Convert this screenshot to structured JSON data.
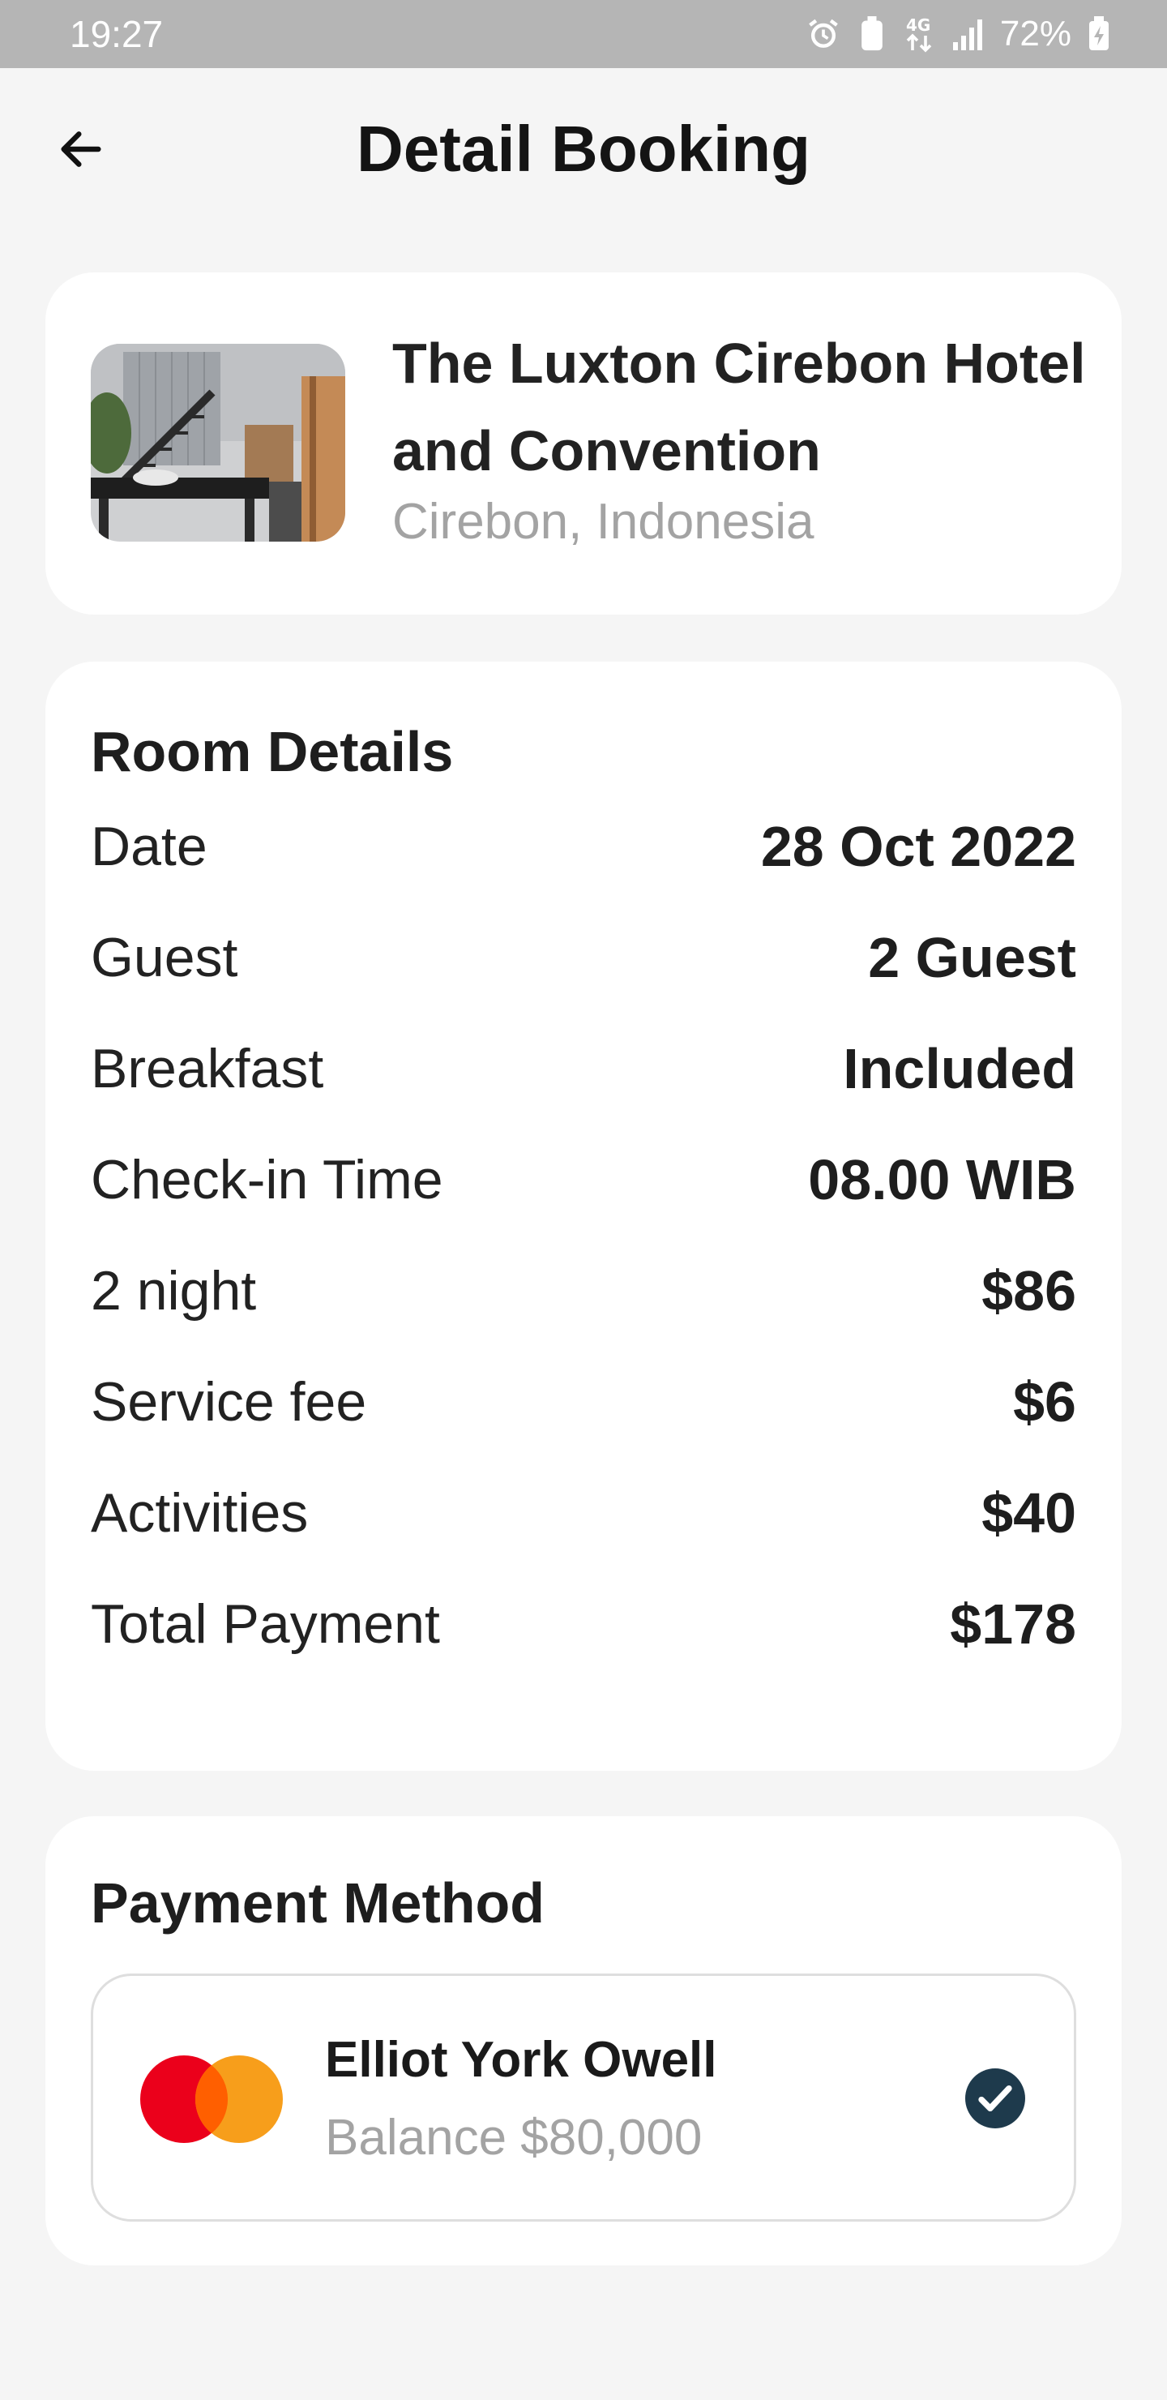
{
  "status_bar": {
    "time": "19:27",
    "network": "4G",
    "battery": "72%"
  },
  "header": {
    "title": "Detail Booking",
    "back_icon": "arrow-left-icon"
  },
  "hotel": {
    "name": "The Luxton Cirebon Hotel and Convention",
    "location": "Cirebon, Indonesia"
  },
  "room_details": {
    "title": "Room Details",
    "rows": [
      {
        "label": "Date",
        "value": "28 Oct 2022"
      },
      {
        "label": "Guest",
        "value": "2 Guest"
      },
      {
        "label": "Breakfast",
        "value": "Included"
      },
      {
        "label": "Check-in Time",
        "value": "08.00 WIB"
      },
      {
        "label": "2 night",
        "value": "$86"
      },
      {
        "label": "Service fee",
        "value": "$6"
      },
      {
        "label": "Activities",
        "value": "$40"
      },
      {
        "label": "Total Payment",
        "value": "$178"
      }
    ]
  },
  "payment_method": {
    "title": "Payment Method",
    "card_holder": "Elliot York Owell",
    "balance": "Balance $80,000",
    "selected": true
  },
  "colors": {
    "background": "#f5f5f5",
    "card": "#ffffff",
    "status_bar": "#b5b5b5",
    "muted_text": "#a3a3a3",
    "check": "#1e3a4c",
    "mastercard_red": "#eb001b",
    "mastercard_orange": "#f79e1b"
  }
}
